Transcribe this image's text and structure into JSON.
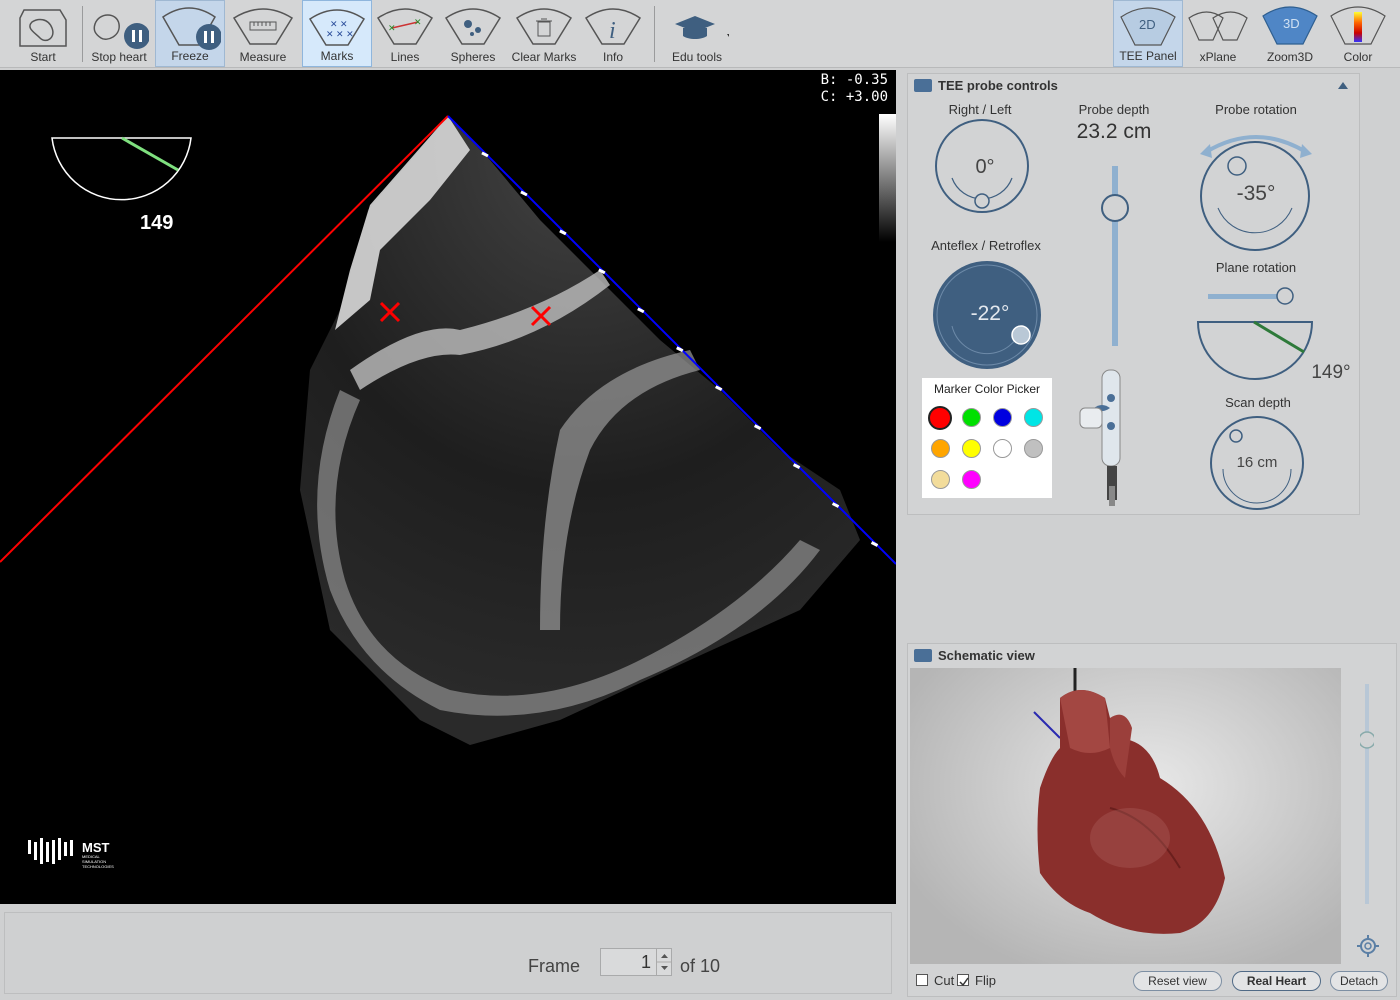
{
  "toolbar": {
    "start": "Start",
    "stop_heart": "Stop heart",
    "freeze": "Freeze",
    "measure": "Measure",
    "marks": "Marks",
    "lines": "Lines",
    "spheres": "Spheres",
    "clear_marks": "Clear Marks",
    "info": "Info",
    "edu_tools": "Edu tools",
    "tee_panel": "TEE Panel",
    "tee_panel_badge": "2D",
    "xplane": "xPlane",
    "zoom3d": "Zoom3D",
    "zoom3d_badge": "3D",
    "color": "Color"
  },
  "viewport": {
    "b_value": "B: -0.35",
    "c_value": "C: +3.00",
    "angle_value": "149",
    "brand": "MST",
    "brand_sub1": "MEDICAL",
    "brand_sub2": "SIMULATION",
    "brand_sub3": "TECHNOLOGIES"
  },
  "frame": {
    "label": "Frame",
    "value": "1",
    "of_label": "of 10"
  },
  "tee": {
    "title": "TEE probe controls",
    "right_left_label": "Right / Left",
    "right_left_value": "0°",
    "probe_depth_label": "Probe depth",
    "probe_depth_value": "23.2 cm",
    "probe_rotation_label": "Probe rotation",
    "probe_rotation_value": "-35°",
    "anteflex_label": "Anteflex / Retroflex",
    "anteflex_value": "-22°",
    "plane_rotation_label": "Plane rotation",
    "plane_rotation_value": "149°",
    "scan_depth_label": "Scan depth",
    "scan_depth_value": "16 cm"
  },
  "color_picker": {
    "title": "Marker Color Picker",
    "colors": [
      "#ff0000",
      "#00e000",
      "#0000e0",
      "#00e5e5",
      "#ffa500",
      "#ffff00",
      "#ffffff",
      "#c0c0c0",
      "#f2dc9b",
      "#ff00ff"
    ],
    "selected": "#ff0000"
  },
  "schematic": {
    "title": "Schematic view",
    "cut_label": "Cut",
    "flip_label": "Flip",
    "reset_view": "Reset view",
    "real_heart": "Real Heart",
    "detach": "Detach"
  },
  "colors": {
    "accent": "#4a6f97",
    "marker": "#ff0000",
    "sector_left": "#ff0000",
    "sector_right": "#0000ff"
  }
}
